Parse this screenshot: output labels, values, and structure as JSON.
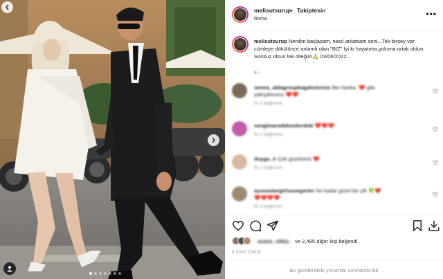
{
  "post": {
    "username": "melisutsurup",
    "separator": "•",
    "follow_label": "Takiptesin",
    "location": "Roma",
    "more_label": "•••",
    "caption_user": "melisutsurup",
    "caption_text": "Nerden başlasam, nasıl anlatsam seni...Tek birşey var cümleye dökülünce anlamlı olan \"BİZ\" İyi ki hayatıma,yoluma ortak oldun. Sonsuz olsun tek dileğim🙏 03/06/2022...",
    "caption_time": "8s",
    "likes_blurred_name": "asana_vibby",
    "likes_rest": " ve 2,495 diğer kişi beğendi",
    "likes_count_bold": "2,495 diğer kişi",
    "time_ago": "8 SAAT ÖNCE",
    "comments_disabled": "Bu gönderideki yorumlar sınırlandırıldı.",
    "carousel_count": 7,
    "carousel_active": 0
  },
  "comments": [
    {
      "user": "semra_aldagroupbagdenivinio",
      "text": "İlke harika. ❤️ gibi",
      "text2": "yakışıklısınız ❤️❤️",
      "meta": "8s   1 beğenme",
      "avatar": "#7a6a5c"
    },
    {
      "user": "sevgiinarodidunderdeki",
      "text": "❤️❤️❤️",
      "text2": "",
      "meta": "8s   1 beğenme",
      "avatar": "#c45aa8"
    },
    {
      "user": "duygu_ir",
      "text": "Çok güzelsiniz ❤️",
      "text2": "",
      "meta": "8s   1 beğenme",
      "avatar": "#d8b8a0"
    },
    {
      "user": "ayseaslangirlsuvegerter",
      "text": "Ne kadar güzel bir çift 🍀❤️",
      "text2": "❤️❤️❤️❤️",
      "meta": "8s   1 beğenme",
      "avatar": "#a08a70"
    }
  ],
  "colors": {
    "heart": "#ed4956",
    "muted": "#8e8e8e",
    "text": "#262626"
  }
}
